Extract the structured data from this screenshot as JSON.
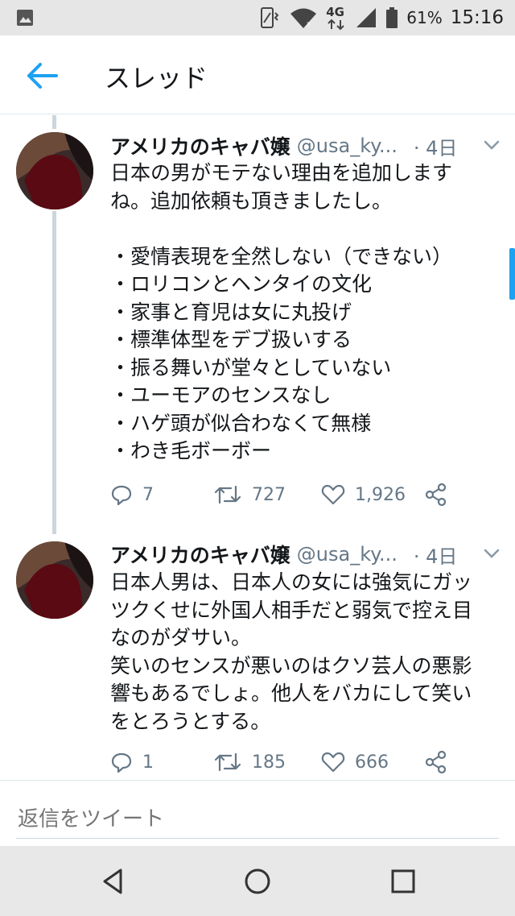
{
  "status_bar": {
    "battery": "61%",
    "network": "4G",
    "time": "15:16"
  },
  "header": {
    "title": "スレッド"
  },
  "tweets": [
    {
      "name": "アメリカのキャバ嬢",
      "handle": "@usa_ky...",
      "time": "· 4日",
      "lines": [
        "日本の男がモテない理由を追加します",
        "ね。追加依頼も頂きましたし。",
        "",
        "・愛情表現を全然しない（できない）",
        "・ロリコンとヘンタイの文化",
        "・家事と育児は女に丸投げ",
        "・標準体型をデブ扱いする",
        "・振る舞いが堂々としていない",
        "・ユーモアのセンスなし",
        "・ハゲ頭が似合わなくて無様",
        "・わき毛ボーボー"
      ],
      "replies": "7",
      "retweets": "727",
      "likes": "1,926"
    },
    {
      "name": "アメリカのキャバ嬢",
      "handle": "@usa_ky...",
      "time": "· 4日",
      "lines": [
        "日本人男は、日本人の女には強気にガッ",
        "ツクくせに外国人相手だと弱気で控え目",
        "なのがダサい。",
        "笑いのセンスが悪いのはクソ芸人の悪影",
        "響もあるでしょ。他人をバカにして笑い",
        "をとろうとする。"
      ],
      "replies": "1",
      "retweets": "185",
      "likes": "666"
    }
  ],
  "reply": {
    "placeholder": "返信をツイート"
  },
  "colors": {
    "accent": "#1da1f2",
    "secondary_text": "#657786",
    "thread_line": "#ccd6dd",
    "avatar_top": "#3a2a2a",
    "avatar_mask": "#5a0a12"
  },
  "icons": [
    "image-icon",
    "vibrate-icon",
    "wifi-icon",
    "signal-icon",
    "battery-icon",
    "back-arrow-icon",
    "chevron-down-icon",
    "reply-icon",
    "retweet-icon",
    "like-icon",
    "share-icon",
    "nav-back-icon",
    "nav-home-icon",
    "nav-recents-icon"
  ]
}
